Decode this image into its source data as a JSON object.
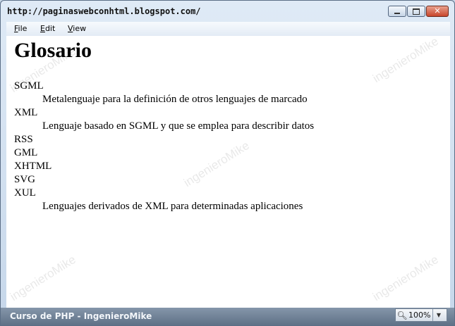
{
  "window": {
    "title": "http://paginaswebconhtml.blogspot.com/"
  },
  "menu": {
    "items": [
      "File",
      "Edit",
      "View"
    ]
  },
  "content": {
    "heading": "Glosario",
    "glossary": [
      {
        "term": "SGML",
        "definition": "Metalenguaje para la definición de otros lenguajes de marcado"
      },
      {
        "term": "XML",
        "definition": "Lenguaje basado en SGML y que se emplea para describir datos"
      },
      {
        "term": "RSS"
      },
      {
        "term": "GML"
      },
      {
        "term": "XHTML"
      },
      {
        "term": "SVG"
      },
      {
        "term": "XUL",
        "definition": "Lenguajes derivados de XML para determinadas aplicaciones"
      }
    ]
  },
  "watermark": "ingenieroMike",
  "status": {
    "text": "Curso de PHP - IngenieroMike",
    "zoom": "100%"
  }
}
